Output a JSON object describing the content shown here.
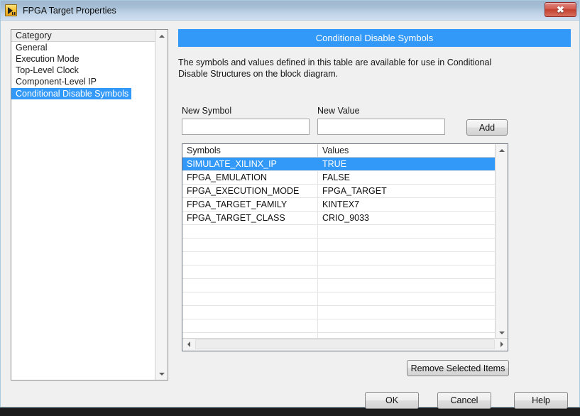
{
  "window": {
    "title": "FPGA Target Properties",
    "icon": "labview-vi-icon",
    "close_label": "✖"
  },
  "sidebar": {
    "header": "Category",
    "items": [
      {
        "label": "General",
        "selected": false
      },
      {
        "label": "Execution Mode",
        "selected": false
      },
      {
        "label": "Top-Level Clock",
        "selected": false
      },
      {
        "label": "Component-Level IP",
        "selected": false
      },
      {
        "label": "Conditional Disable Symbols",
        "selected": true
      }
    ]
  },
  "main": {
    "banner_title": "Conditional Disable Symbols",
    "description": "The symbols and values defined in this table are available for use in Conditional Disable Structures on the block diagram.",
    "new_symbol": {
      "label": "New Symbol",
      "value": "",
      "placeholder": ""
    },
    "new_value": {
      "label": "New Value",
      "value": "",
      "placeholder": ""
    },
    "add_label": "Add",
    "remove_label": "Remove Selected Items",
    "table": {
      "columns": [
        "Symbols",
        "Values"
      ],
      "rows": [
        {
          "symbol": "SIMULATE_XILINX_IP",
          "value": "TRUE",
          "selected": true
        },
        {
          "symbol": "FPGA_EMULATION",
          "value": "FALSE",
          "selected": false
        },
        {
          "symbol": "FPGA_EXECUTION_MODE",
          "value": "FPGA_TARGET",
          "selected": false
        },
        {
          "symbol": "FPGA_TARGET_FAMILY",
          "value": "KINTEX7",
          "selected": false
        },
        {
          "symbol": "FPGA_TARGET_CLASS",
          "value": "CRIO_9033",
          "selected": false
        }
      ],
      "empty_row_count": 9
    }
  },
  "footer": {
    "ok_label": "OK",
    "cancel_label": "Cancel",
    "help_label": "Help"
  },
  "colors": {
    "accent_blue": "#3399f8",
    "selection_blue": "#3399f8",
    "window_bg": "#f0f0f0",
    "close_red": "#c2402f"
  }
}
